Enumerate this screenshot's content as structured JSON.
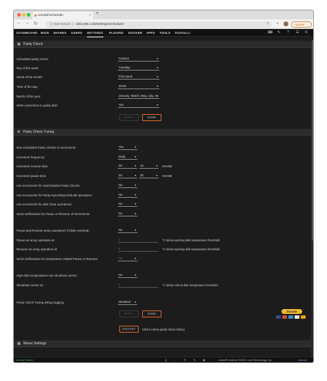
{
  "browser": {
    "tab_title": "Unraid/Scheduler",
    "tab_close": "×",
    "new_tab": "+",
    "url_security": "Not Secure",
    "url_separator": "|",
    "url": "192.168.1.25/Settings/Scheduler",
    "update_label": "Update",
    "update_caret": "⋮",
    "back": "←",
    "forward": "→",
    "reload": "↻"
  },
  "nav": {
    "items": [
      "DASHBOARD",
      "MAIN",
      "SHARES",
      "USERS",
      "SETTINGS",
      "PLUGINS",
      "DOCKER",
      "APPS",
      "TOOLS",
      "TAUTULLI"
    ],
    "active": "SETTINGS"
  },
  "parity_check": {
    "title": "Parity Check",
    "rows": [
      {
        "label": "Scheduled parity check:",
        "value": "Custom"
      },
      {
        "label": "Day of the week:",
        "value": "Tuesday"
      },
      {
        "label": "Week of the month:",
        "value": "First week"
      },
      {
        "label": "Time of the day:",
        "value": "20:00"
      },
      {
        "label": "Month of the year:",
        "value": "January, March, May, July, S"
      },
      {
        "label": "Write corrections to parity disk:",
        "value": "Yes"
      }
    ],
    "apply_label": "APPLY",
    "done_label": "DONE"
  },
  "tuning": {
    "title": "Parity Check Tuning",
    "increments": {
      "label": "Run scheduled Parity Checks in Increments:",
      "value": "Yes"
    },
    "frequency": {
      "label": "Increment frequency:",
      "value": "Daily"
    },
    "resume_time": {
      "label": "Increment resume time:",
      "hours": "00",
      "minutes": "15",
      "unit": "HH:MM"
    },
    "pause_time": {
      "label": "Increment pause time:",
      "hours": "03",
      "minutes": "30",
      "unit": "HH:MM"
    },
    "unscheduled": {
      "label": "Use increments for unscheduled Parity Checks",
      "value": "No"
    },
    "parity_sync": {
      "label": "Use increments for Parity-Sync/Data Rebuild operations:",
      "value": "No"
    },
    "disk_clear": {
      "label": "Use increments for disk Clear operations:",
      "value": "No"
    },
    "notify_increments": {
      "label": "Send notifications for Pause or Resume of Increments:",
      "value": "No"
    },
    "overheat": {
      "label": "Pause and Resume array operations if disks overheat:",
      "value": "No"
    },
    "pause_at": {
      "label": "Pause an array operation at:",
      "value": "3",
      "note": "°C below warning disk temperature threshold"
    },
    "resume_at": {
      "label": "Resume an array operation at:",
      "value": "6",
      "note": "°C below warning disk temperature threshold"
    },
    "temp_notify": {
      "label": "Send notifications for temperature related Pause or Resume:",
      "value": "No"
    },
    "shutdown": {
      "label": "High disk temperatures can shutdown server:",
      "value": "No"
    },
    "shutdown_at": {
      "label": "Shutdown server at:",
      "value": "1",
      "note": "°C below critical disk temperature threshold"
    },
    "debug": {
      "label": "Parity Check Tuning debug logging:",
      "value": "Disabled"
    },
    "apply_label": "APPLY",
    "done_label": "DONE",
    "history_label": "HISTORY",
    "history_note": "Click to show parity-check history"
  },
  "mover": {
    "title": "Mover Settings"
  },
  "donate": {
    "label": "Donate"
  },
  "status": {
    "array": "Array Started",
    "copyright": "Unraid® webGui ©2020, Lime Technology, Inc.",
    "manual": "manual"
  },
  "colors": {
    "accent": "#e3692a",
    "started": "#4fb14f",
    "panel": "#1c1c1c",
    "header": "#2b2b2b"
  }
}
